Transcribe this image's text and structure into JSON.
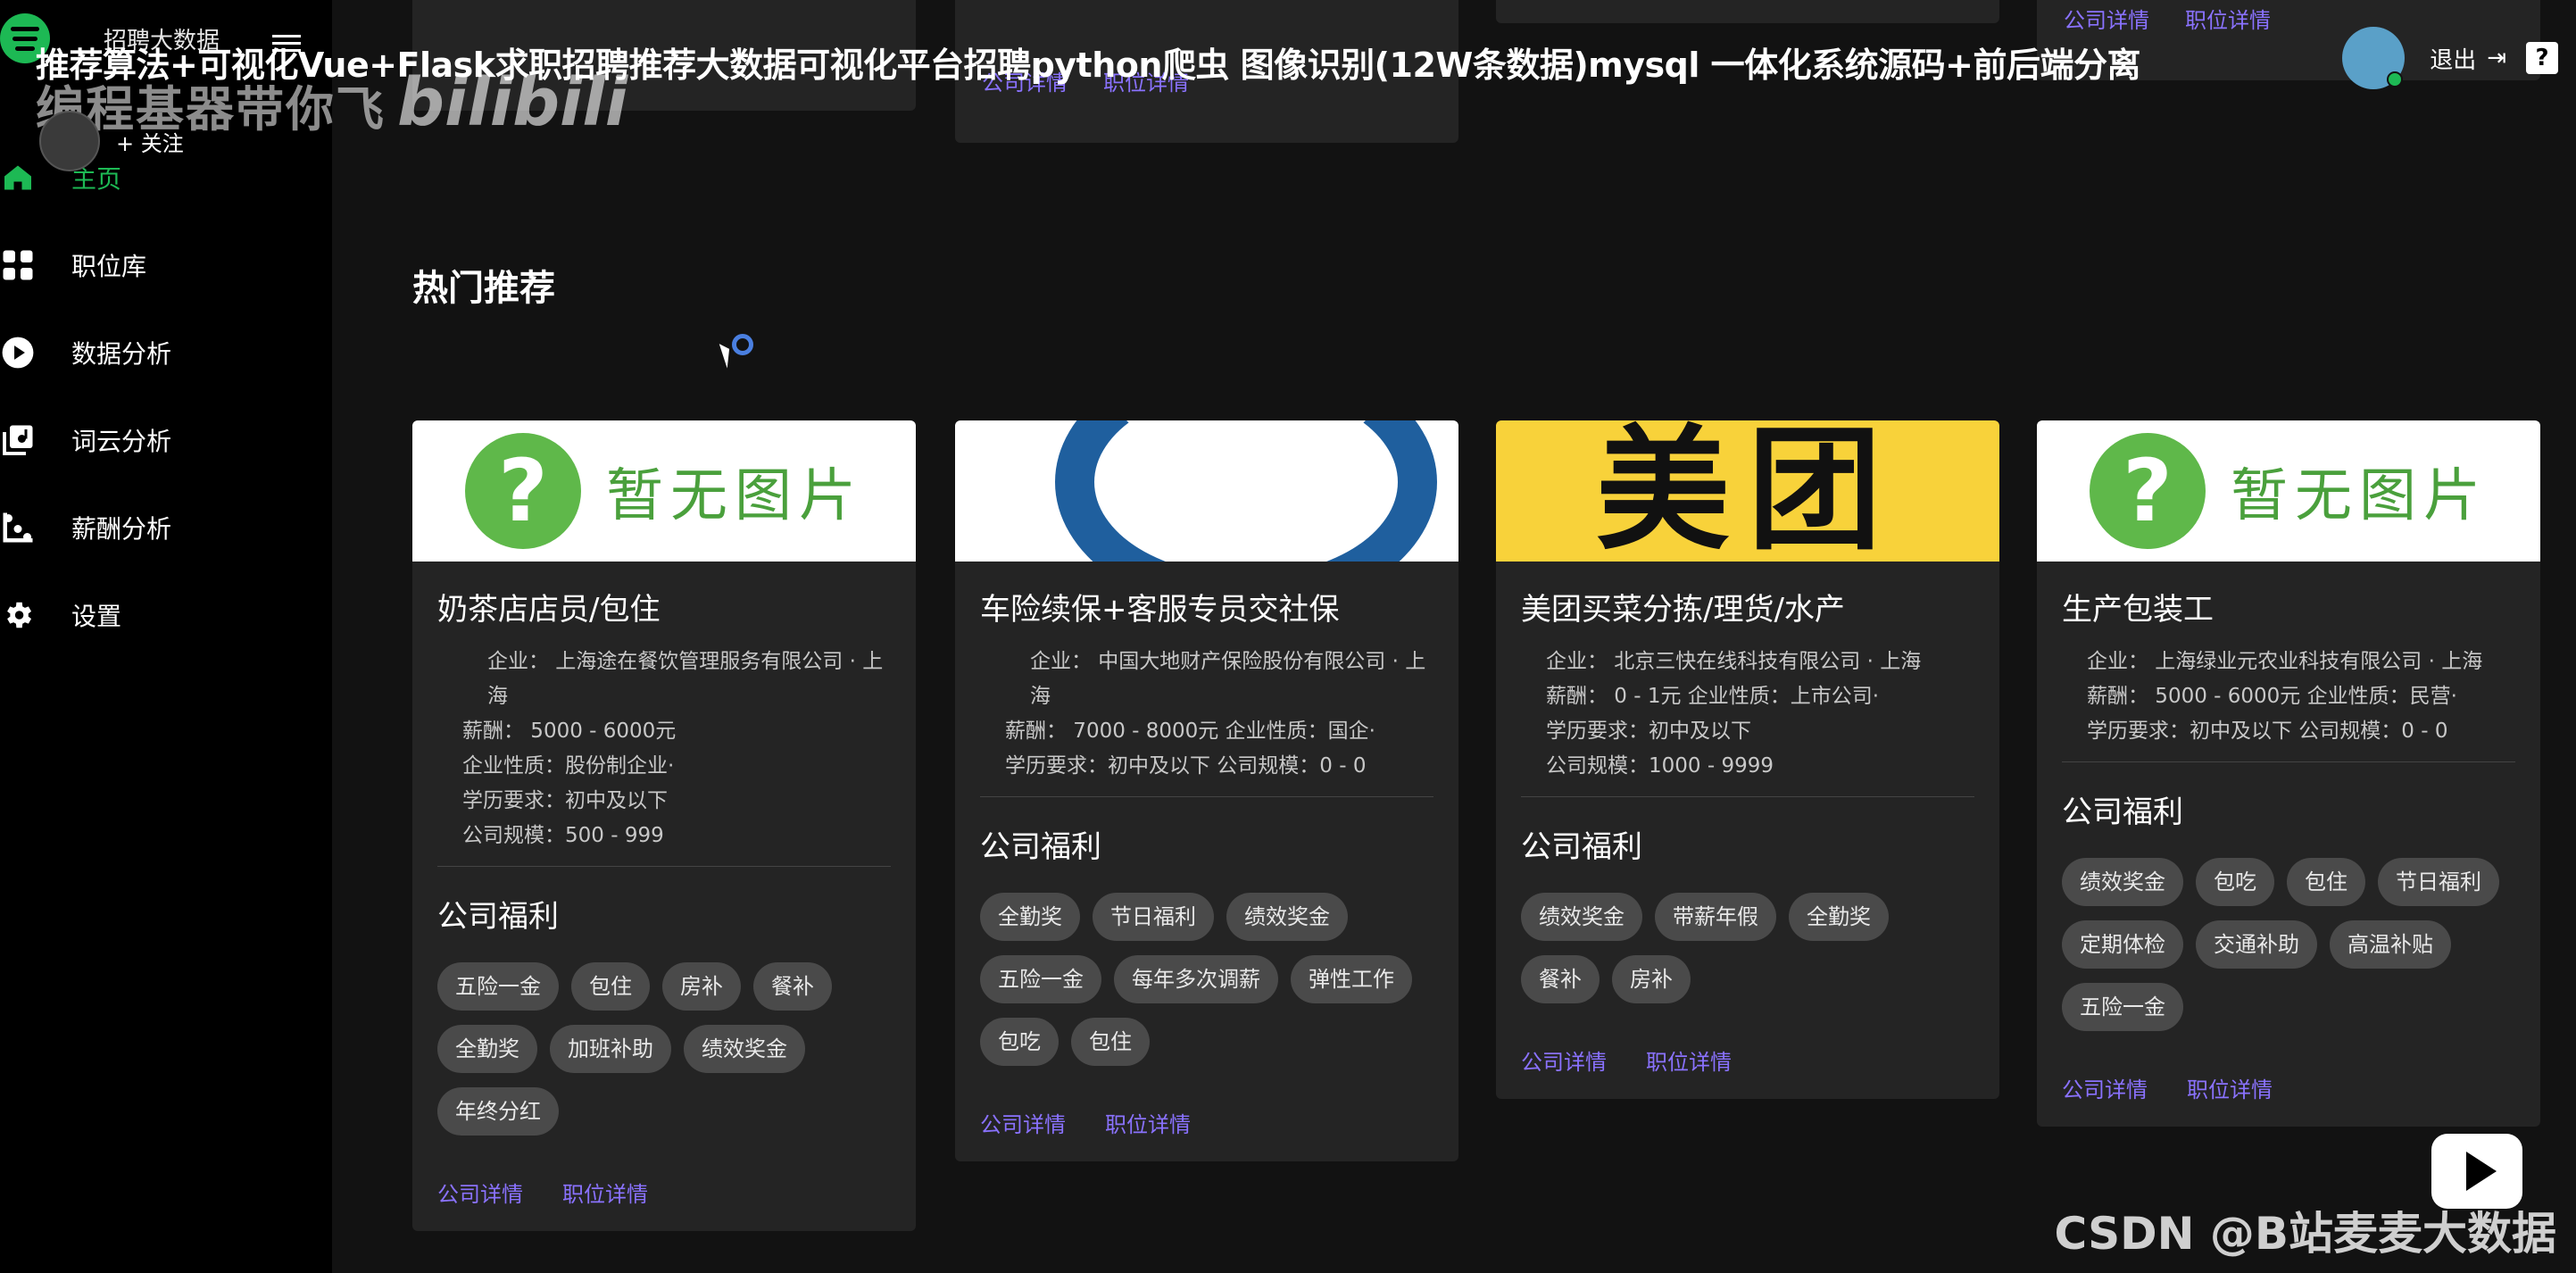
{
  "brand": {
    "name": "招聘大数据"
  },
  "overlay": {
    "title": "推荐算法+可视化Vue+Flask求职招聘推荐大数据可视化平台招聘python爬虫 图像识别(12W条数据)mysql 一体化系统源码+前后端分离",
    "watermark": "编程基器带你飞",
    "bili": "bilibili",
    "follow": "+ 关注",
    "csdn": "CSDN @B站麦麦大数据"
  },
  "nav": [
    {
      "label": "主页",
      "icon": "home-icon"
    },
    {
      "label": "职位库",
      "icon": "grid-icon"
    },
    {
      "label": "数据分析",
      "icon": "play-circle-icon"
    },
    {
      "label": "词云分析",
      "icon": "library-icon"
    },
    {
      "label": "薪酬分析",
      "icon": "scatter-icon"
    },
    {
      "label": "设置",
      "icon": "gear-icon"
    }
  ],
  "header": {
    "logout": "退出",
    "help": "?"
  },
  "section": {
    "title": "热门推荐"
  },
  "top_links": {
    "company": "公司详情",
    "job": "职位详情"
  },
  "cards": [
    {
      "image": "暂无图片",
      "title": "奶茶店店员/包住",
      "info": [
        "企业：  上海途在餐饮管理服务有限公司 · 上海",
        "薪酬：  5000 - 6000元",
        "企业性质：股份制企业·",
        "学历要求：初中及以下",
        "公司规模：500 - 999"
      ],
      "benefit_title": "公司福利",
      "tags": [
        "五险一金",
        "包住",
        "房补",
        "餐补",
        "全勤奖",
        "加班补助",
        "绩效奖金",
        "年终分红"
      ],
      "company_link": "公司详情",
      "job_link": "职位详情"
    },
    {
      "image": "",
      "title": "车险续保+客服专员交社保",
      "info": [
        "企业：  中国大地财产保险股份有限公司 · 上海",
        "薪酬：  7000 - 8000元   企业性质：国企·",
        "学历要求：初中及以下   公司规模：0 - 0"
      ],
      "benefit_title": "公司福利",
      "tags": [
        "全勤奖",
        "节日福利",
        "绩效奖金",
        "五险一金",
        "每年多次调薪",
        "弹性工作",
        "包吃",
        "包住"
      ],
      "company_link": "公司详情",
      "job_link": "职位详情"
    },
    {
      "image": "美团",
      "title": "美团买菜分拣/理货/水产",
      "info": [
        "企业：  北京三快在线科技有限公司 · 上海",
        "薪酬：  0 - 1元   企业性质：上市公司·",
        "学历要求：初中及以下",
        "公司规模：1000 - 9999"
      ],
      "benefit_title": "公司福利",
      "tags": [
        "绩效奖金",
        "带薪年假",
        "全勤奖",
        "餐补",
        "房补"
      ],
      "company_link": "公司详情",
      "job_link": "职位详情"
    },
    {
      "image": "暂无图片",
      "title": "生产包装工",
      "info": [
        "企业：  上海绿业元农业科技有限公司 · 上海",
        "薪酬：  5000 - 6000元   企业性质：民营·",
        "学历要求：初中及以下   公司规模：0 - 0"
      ],
      "benefit_title": "公司福利",
      "tags": [
        "绩效奖金",
        "包吃",
        "包住",
        "节日福利",
        "定期体检",
        "交通补助",
        "高温补贴",
        "五险一金"
      ],
      "company_link": "公司详情",
      "job_link": "职位详情"
    }
  ]
}
